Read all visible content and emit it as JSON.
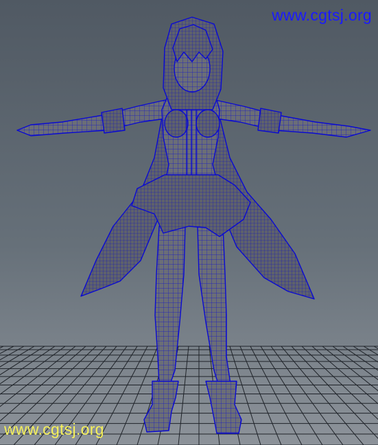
{
  "viewport": {
    "watermark_top": "www.cgtsj.org",
    "watermark_bottom": "www.cgtsj.org",
    "colors": {
      "background_top": "#505963",
      "background_bottom": "#8d939a",
      "grid": "#1f2329",
      "mesh_fill": "#6b6e77",
      "mesh_wire": "#0a0ad2",
      "watermark_top": "#1a1aff",
      "watermark_bottom": "#f5f05a"
    },
    "content": "3D wireframe character model in T-pose on a perspective grid"
  }
}
